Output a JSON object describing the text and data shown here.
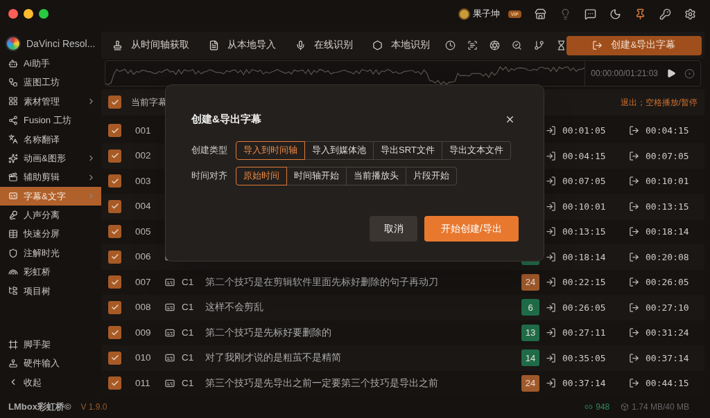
{
  "user": {
    "name": "果子坤",
    "badge": "VIP"
  },
  "app": {
    "name": "DaVinci Resol..."
  },
  "sidebar": {
    "items": [
      {
        "label": "Ai助手",
        "has_submenu": false,
        "selected": false
      },
      {
        "label": "蓝图工坊",
        "has_submenu": false,
        "selected": false
      },
      {
        "label": "素材管理",
        "has_submenu": true,
        "selected": false
      },
      {
        "label": "Fusion 工坊",
        "has_submenu": false,
        "selected": false
      },
      {
        "label": "名称翻译",
        "has_submenu": false,
        "selected": false
      },
      {
        "label": "动画&图形",
        "has_submenu": true,
        "selected": false
      },
      {
        "label": "辅助剪辑",
        "has_submenu": true,
        "selected": false
      },
      {
        "label": "字幕&文字",
        "has_submenu": true,
        "selected": true
      },
      {
        "label": "人声分离",
        "has_submenu": false,
        "selected": false
      },
      {
        "label": "快速分屏",
        "has_submenu": false,
        "selected": false
      },
      {
        "label": "注解时光",
        "has_submenu": false,
        "selected": false
      },
      {
        "label": "彩虹桥",
        "has_submenu": false,
        "selected": false
      },
      {
        "label": "项目树",
        "has_submenu": false,
        "selected": false
      }
    ],
    "bottom_items": [
      {
        "label": "脚手架"
      },
      {
        "label": "硬件输入"
      },
      {
        "label": "收起"
      }
    ]
  },
  "toolbar": {
    "actions": [
      {
        "label": "从时间轴获取"
      },
      {
        "label": "从本地导入"
      },
      {
        "label": "在线识别"
      },
      {
        "label": "本地识别"
      }
    ],
    "primary": "创建&导出字幕"
  },
  "player": {
    "time": "00:00:00/01:21:03"
  },
  "table": {
    "header": {
      "checked": true,
      "label": "当前字幕",
      "hint": "退出；空格播放/暂停"
    },
    "rows": [
      {
        "index": "001",
        "checked": true,
        "start": "00:01:05",
        "end": "00:04:15"
      },
      {
        "index": "002",
        "checked": true,
        "start": "00:04:15",
        "end": "00:07:05"
      },
      {
        "index": "003",
        "checked": true,
        "start": "00:07:05",
        "end": "00:10:01"
      },
      {
        "index": "004",
        "checked": true,
        "start": "00:10:01",
        "end": "00:13:15"
      },
      {
        "index": "005",
        "checked": true,
        "start": "00:13:15",
        "end": "00:18:14"
      },
      {
        "index": "006",
        "checked": true,
        "badge": {
          "color": "#1f6b48"
        },
        "start": "00:18:14",
        "end": "00:20:08"
      },
      {
        "index": "007",
        "checked": true,
        "track": "C1",
        "text": "第二个技巧是在剪辑软件里面先标好删除的句子再动刀",
        "badge": {
          "count": "24",
          "color": "#a0592a"
        },
        "start": "00:22:15",
        "end": "00:26:05"
      },
      {
        "index": "008",
        "checked": true,
        "track": "C1",
        "text": "这样不会剪乱",
        "badge": {
          "count": "6",
          "color": "#1f6b48"
        },
        "start": "00:26:05",
        "end": "00:27:10"
      },
      {
        "index": "009",
        "checked": true,
        "track": "C1",
        "text": "第二个技巧是先标好要删除的",
        "badge": {
          "count": "13",
          "color": "#1f6b48"
        },
        "start": "00:27:11",
        "end": "00:31:24"
      },
      {
        "index": "010",
        "checked": true,
        "track": "C1",
        "text": "对了我刚才说的是粗茧不是精简",
        "badge": {
          "count": "14",
          "color": "#1f6b48"
        },
        "start": "00:35:05",
        "end": "00:37:14"
      },
      {
        "index": "011",
        "checked": true,
        "track": "C1",
        "text": "第三个技巧是先导出之前一定要第三个技巧是导出之前",
        "badge": {
          "count": "24",
          "color": "#a0592a"
        },
        "start": "00:37:14",
        "end": "00:44:15"
      }
    ]
  },
  "dialog": {
    "title": "创建&导出字幕",
    "groups": [
      {
        "label": "创建类型",
        "options": [
          {
            "label": "导入到时间轴",
            "selected": true
          },
          {
            "label": "导入到媒体池",
            "selected": false
          },
          {
            "label": "导出SRT文件",
            "selected": false
          },
          {
            "label": "导出文本文件",
            "selected": false
          }
        ]
      },
      {
        "label": "时间对齐",
        "options": [
          {
            "label": "原始时间",
            "selected": true
          },
          {
            "label": "时间轴开始",
            "selected": false
          },
          {
            "label": "当前播放头",
            "selected": false
          },
          {
            "label": "片段开始",
            "selected": false
          }
        ]
      }
    ],
    "cancel": "取消",
    "confirm": "开始创建/导出"
  },
  "footer": {
    "logo": "LMbox彩虹桥©",
    "version": "V 1.9.0",
    "count": "948",
    "storage": "1.74 MB/40 MB"
  }
}
